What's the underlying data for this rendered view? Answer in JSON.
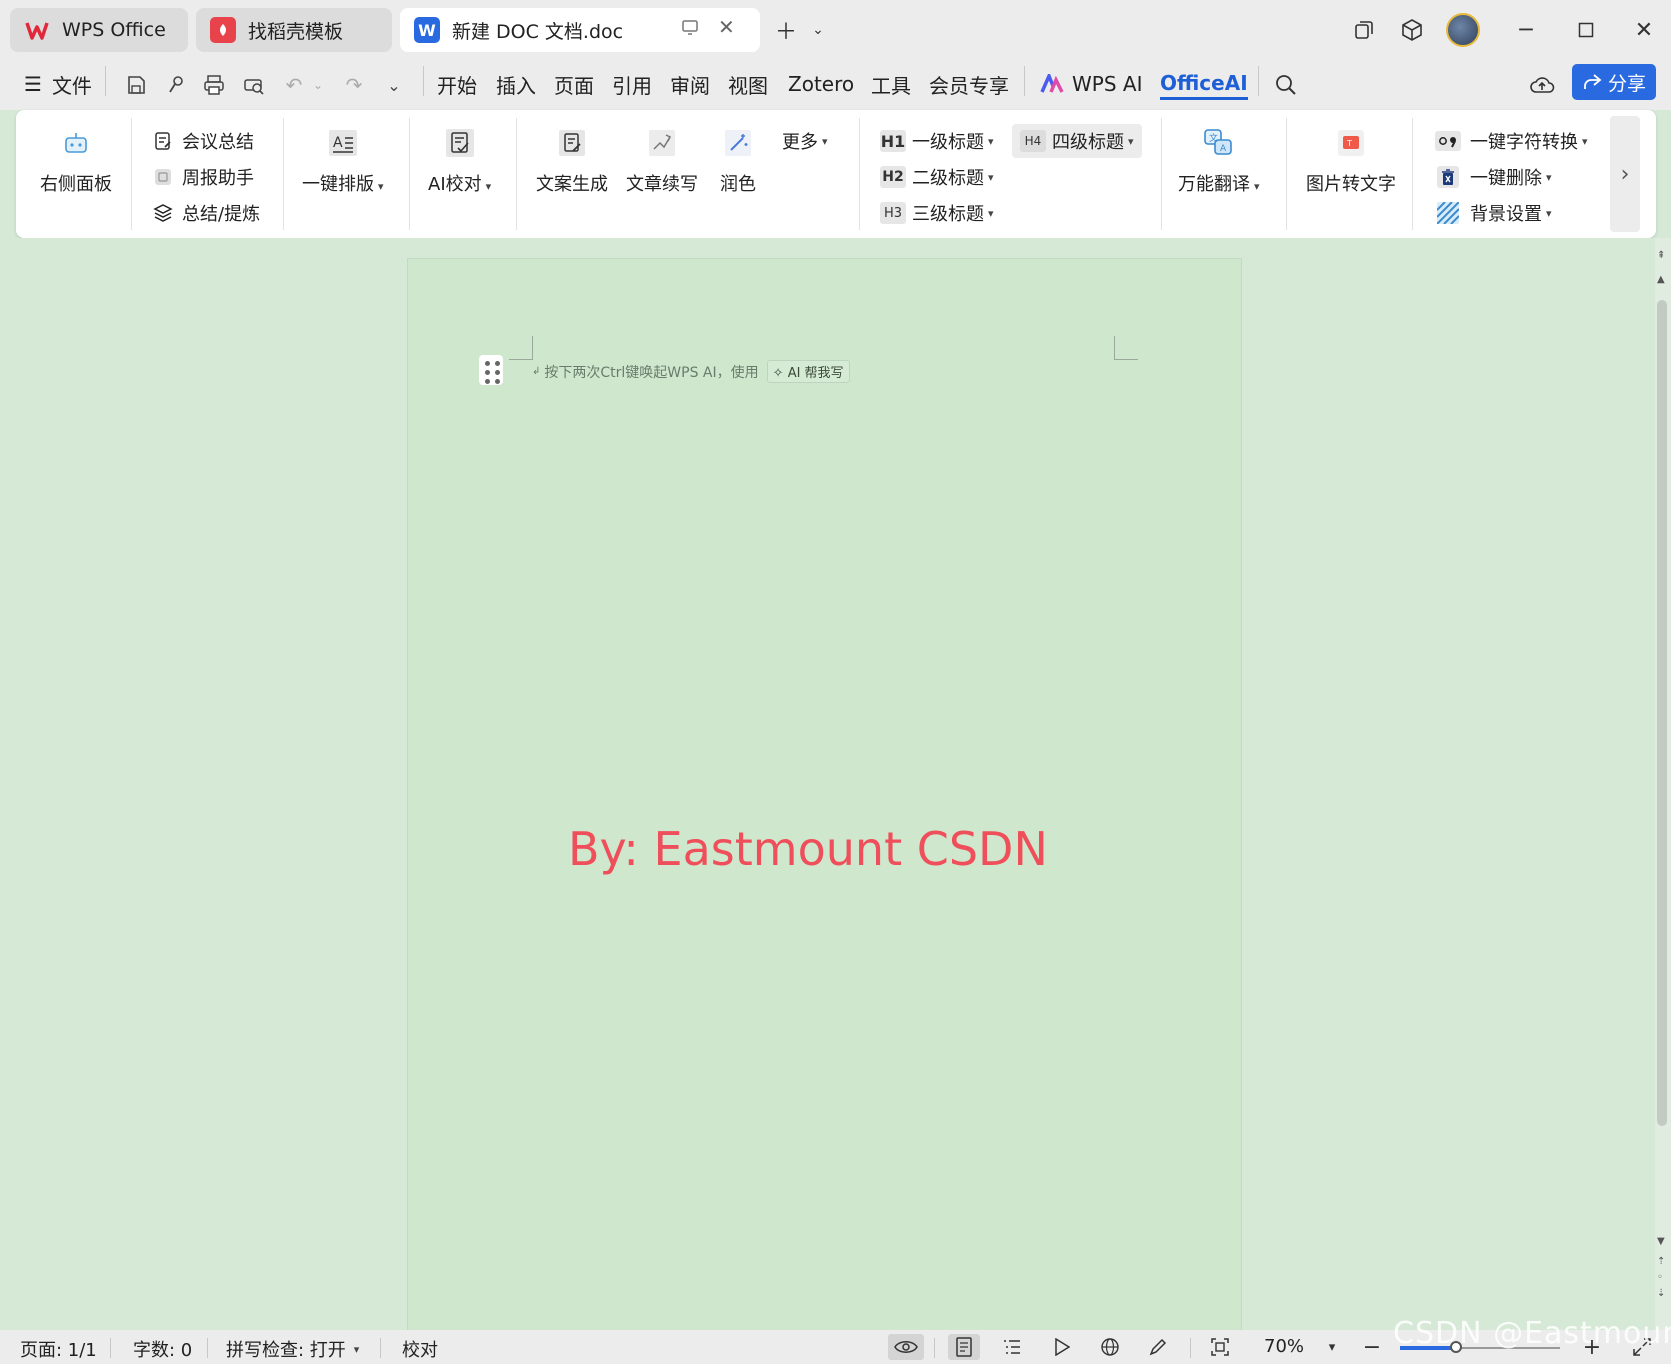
{
  "tabs": [
    {
      "label": "WPS Office",
      "icon": "wps-logo-icon",
      "color": "#e0283a",
      "active": false
    },
    {
      "label": "找稻壳模板",
      "icon": "docer-icon",
      "color": "#e8424b",
      "active": false
    },
    {
      "label": "新建 DOC 文档.doc",
      "icon": "word-doc-icon",
      "color": "#2a6ae0",
      "active": true
    }
  ],
  "menu": {
    "file_label": "文件",
    "items": [
      "开始",
      "插入",
      "页面",
      "引用",
      "审阅",
      "视图",
      "Zotero",
      "工具",
      "会员专享"
    ],
    "wps_ai_label": "WPS AI",
    "officeai_label": "OfficeAI",
    "share_label": "分享"
  },
  "ribbon": {
    "right_panel": "右侧面板",
    "meeting_summary": "会议总结",
    "weekly_assistant": "周报助手",
    "summary_refine": "总结/提炼",
    "one_click_layout": "一键排版",
    "ai_proofread": "AI校对",
    "copy_generate": "文案生成",
    "article_continue": "文章续写",
    "polish": "润色",
    "more": "更多",
    "h1": {
      "badge": "H1",
      "label": "一级标题"
    },
    "h2": {
      "badge": "H2",
      "label": "二级标题"
    },
    "h3": {
      "badge": "H3",
      "label": "三级标题"
    },
    "h4": {
      "badge": "H4",
      "label": "四级标题"
    },
    "translate": "万能翻译",
    "image_to_text": "图片转文字",
    "char_convert": "一键字符转换",
    "one_click_delete": "一键删除",
    "background_settings": "背景设置"
  },
  "document": {
    "hint": "按下两次Ctrl键唤起WPS AI，使用",
    "ai_help": "AI 帮我写",
    "body_text": "By: Eastmount CSDN"
  },
  "status": {
    "page": "页面: 1/1",
    "word_count": "字数: 0",
    "spell_check": "拼写检查: 打开",
    "proofread": "校对",
    "zoom": "70%",
    "zoom_level": 0.35
  },
  "watermark": "CSDN @Eastmount",
  "colors": {
    "accent": "#1f5fd6",
    "share_button": "#2a6ae0",
    "page_bg": "#cfe8cd",
    "watermark_text": "#ef4f5b"
  }
}
